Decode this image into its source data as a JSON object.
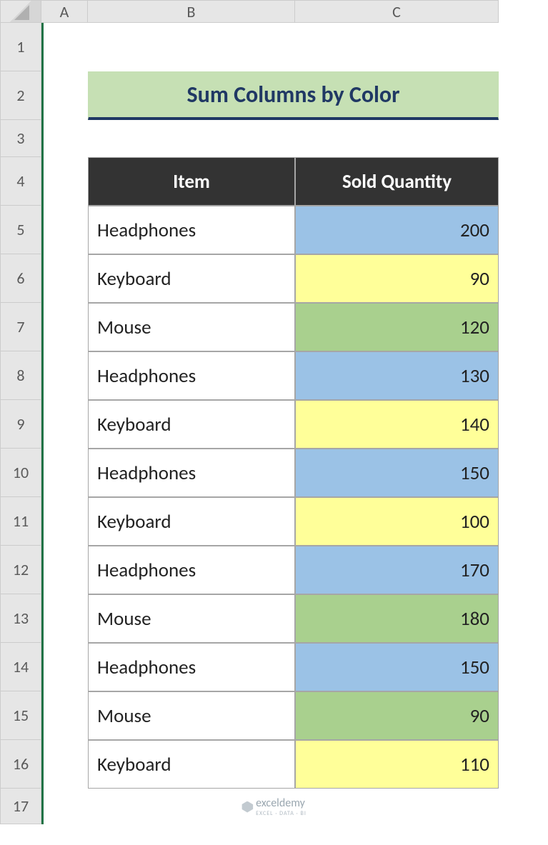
{
  "columns": [
    "A",
    "B",
    "C"
  ],
  "rows": [
    "1",
    "2",
    "3",
    "4",
    "5",
    "6",
    "7",
    "8",
    "9",
    "10",
    "11",
    "12",
    "13",
    "14",
    "15",
    "16",
    "17"
  ],
  "title": "Sum Columns by Color",
  "headers": {
    "item": "Item",
    "qty": "Sold Quantity"
  },
  "data": [
    {
      "item": "Headphones",
      "qty": "200",
      "color": "blue"
    },
    {
      "item": "Keyboard",
      "qty": "90",
      "color": "yellow"
    },
    {
      "item": "Mouse",
      "qty": "120",
      "color": "green"
    },
    {
      "item": "Headphones",
      "qty": "130",
      "color": "blue"
    },
    {
      "item": "Keyboard",
      "qty": "140",
      "color": "yellow"
    },
    {
      "item": "Headphones",
      "qty": "150",
      "color": "blue"
    },
    {
      "item": "Keyboard",
      "qty": "100",
      "color": "yellow"
    },
    {
      "item": "Headphones",
      "qty": "170",
      "color": "blue"
    },
    {
      "item": "Mouse",
      "qty": "180",
      "color": "green"
    },
    {
      "item": "Headphones",
      "qty": "150",
      "color": "blue"
    },
    {
      "item": "Mouse",
      "qty": "90",
      "color": "green"
    },
    {
      "item": "Keyboard",
      "qty": "110",
      "color": "yellow"
    }
  ],
  "logo": {
    "name": "exceldemy",
    "sub": "EXCEL · DATA · BI"
  }
}
